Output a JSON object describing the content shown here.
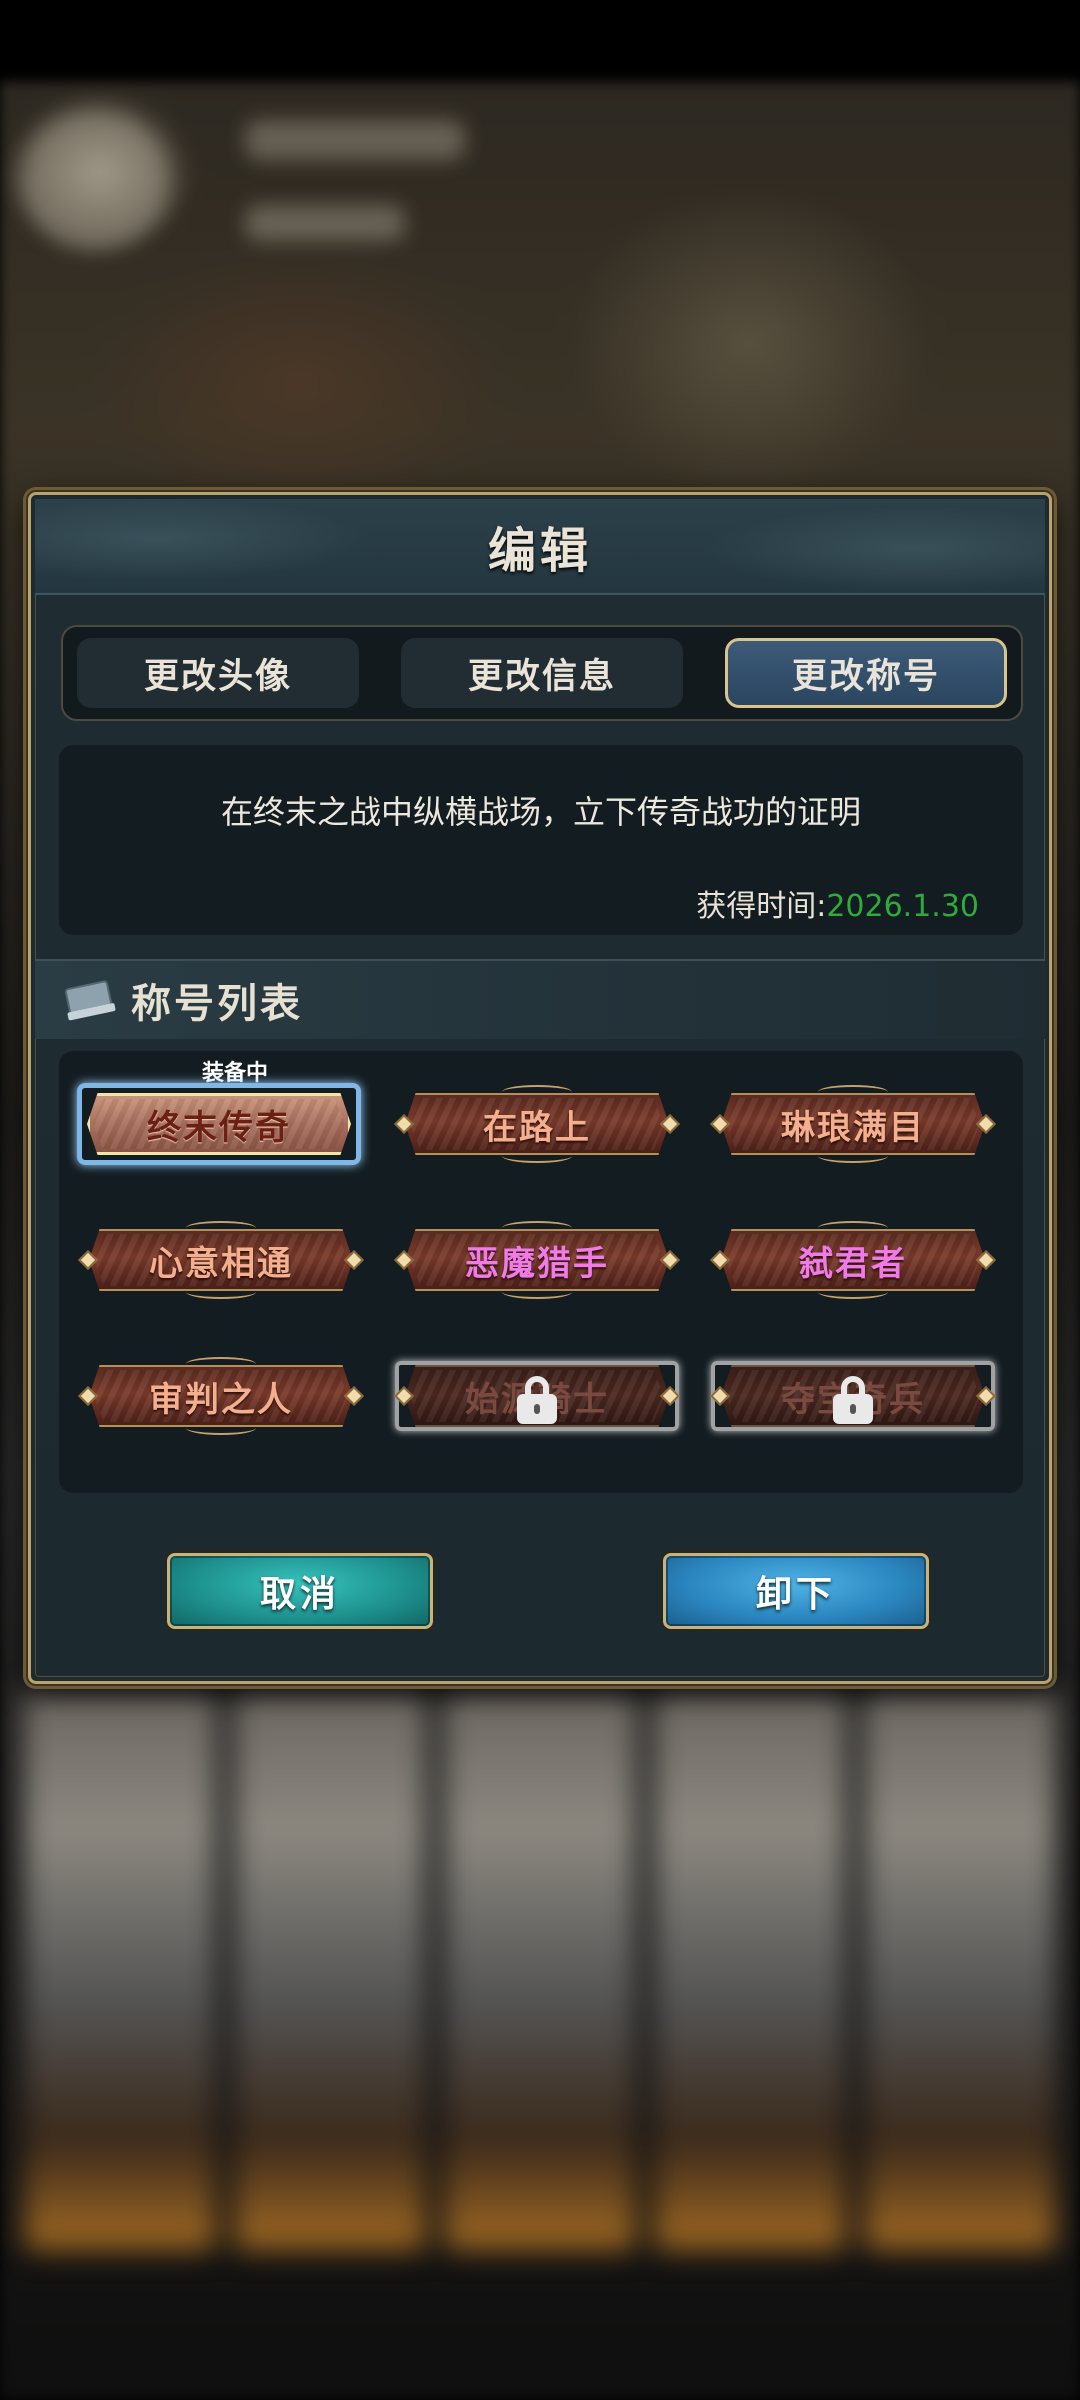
{
  "dialog": {
    "title": "编辑",
    "tabs": [
      {
        "label": "更改头像",
        "active": false
      },
      {
        "label": "更改信息",
        "active": false
      },
      {
        "label": "更改称号",
        "active": true
      }
    ],
    "description": "在终末之战中纵横战场，立下传奇战功的证明",
    "obtain_time_label": "获得时间:",
    "obtain_time_value": "2026.1.30",
    "section_title": "称号列表",
    "section_icon": "book-icon",
    "equipped_label": "装备中",
    "titles": [
      {
        "label": "终末传奇",
        "state": "equipped",
        "color": "#6a2014"
      },
      {
        "label": "在路上",
        "state": "available",
        "color": "#f4b08e"
      },
      {
        "label": "琳琅满目",
        "state": "available",
        "color": "#f4b08e"
      },
      {
        "label": "心意相通",
        "state": "available",
        "color": "#f4b08e"
      },
      {
        "label": "恶魔猎手",
        "state": "available",
        "color": "#f07be6"
      },
      {
        "label": "弑君者",
        "state": "available",
        "color": "#f07be6"
      },
      {
        "label": "审判之人",
        "state": "available",
        "color": "#f4b08e"
      },
      {
        "label": "始源骑士",
        "state": "locked",
        "color": "#7a4a40"
      },
      {
        "label": "夺宝奇兵",
        "state": "locked",
        "color": "#7a4a40"
      }
    ],
    "buttons": {
      "cancel": "取消",
      "unequip": "卸下"
    }
  }
}
